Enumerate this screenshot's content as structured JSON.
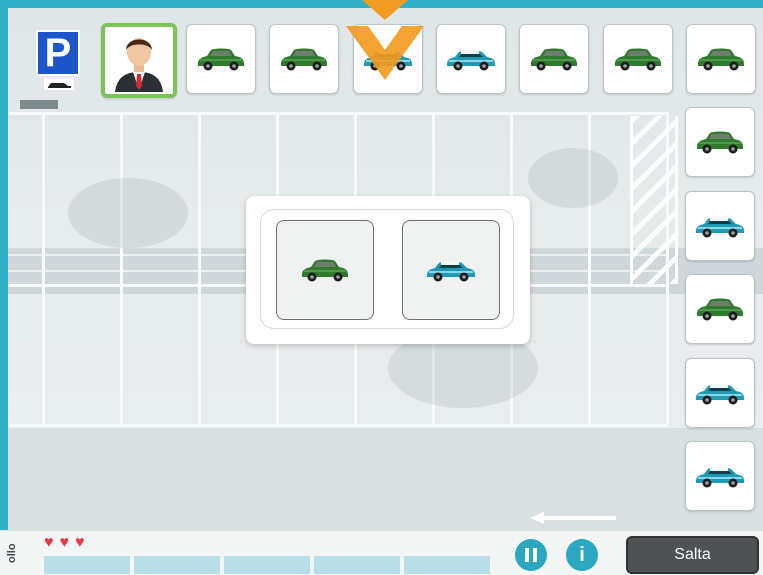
{
  "parking_sign": {
    "letter": "P",
    "icon": "parking-sign-icon"
  },
  "player": {
    "icon": "businessman-avatar-icon",
    "selected": true
  },
  "top_queue": [
    {
      "color": "green",
      "icon": "green-car-icon"
    },
    {
      "color": "green",
      "icon": "green-car-icon"
    },
    {
      "color": "teal",
      "icon": "teal-car-icon"
    },
    {
      "color": "teal",
      "icon": "teal-car-icon"
    },
    {
      "color": "green",
      "icon": "green-car-icon"
    },
    {
      "color": "green",
      "icon": "green-car-icon"
    },
    {
      "color": "green",
      "icon": "green-car-icon"
    }
  ],
  "side_queue": [
    {
      "color": "green",
      "icon": "green-car-icon"
    },
    {
      "color": "teal",
      "icon": "teal-car-icon"
    },
    {
      "color": "green",
      "icon": "green-car-icon"
    },
    {
      "color": "teal",
      "icon": "teal-car-icon"
    },
    {
      "color": "teal",
      "icon": "teal-car-icon"
    }
  ],
  "choices": [
    {
      "color": "green",
      "icon": "green-car-icon"
    },
    {
      "color": "teal",
      "icon": "teal-car-icon"
    }
  ],
  "pointer": {
    "icon": "chevron-down-icon",
    "color": "#f29b21"
  },
  "lives": {
    "count": 3,
    "icon": "heart-icon",
    "color": "#e43a45"
  },
  "progress": {
    "segments": 5,
    "color": "#b9dfe6"
  },
  "bottom_bar": {
    "side_label": "ollo",
    "pause_icon": "pause-icon",
    "info_label": "i",
    "skip_label": "Salta"
  },
  "colors": {
    "frame": "#2fb0c6",
    "green_car": "#2f7a2c",
    "teal_car": "#1f9ab5",
    "accent_border": "#7cc35a"
  }
}
